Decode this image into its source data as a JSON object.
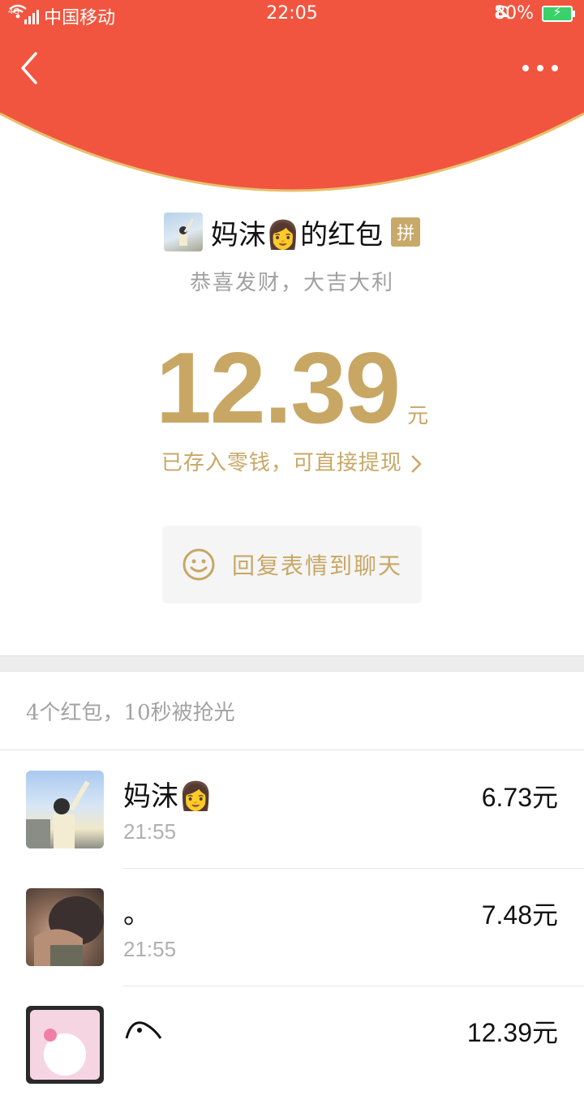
{
  "status_bar": {
    "network_type": "4G",
    "carrier": "中国移动",
    "time": "22:05",
    "battery": "80%",
    "icons": [
      "signal-icon",
      "wifi-icon",
      "mute-bell-icon",
      "battery-icon"
    ]
  },
  "header": {
    "background_color": "#f2553f",
    "accent_color": "#e6c06e",
    "back_icon": "back-arrow-icon",
    "more_icon": "more-dots-icon"
  },
  "packet": {
    "sender_name": "妈沫👩的红包",
    "badge": "拼",
    "blessing": "恭喜发财，大吉大利",
    "amount": "12.39",
    "unit": "元",
    "deposit_note": "已存入零钱，可直接提现",
    "reply_label": "回复表情到聊天",
    "reply_icon": "smiley-icon"
  },
  "summary": "4个红包，10秒被抢光",
  "receivers": [
    {
      "name": "妈沫👩",
      "time": "21:55",
      "amount": "6.73元"
    },
    {
      "name": "。",
      "time": "21:55",
      "amount": "7.48元"
    },
    {
      "name": "",
      "time": "",
      "amount": "12.39元"
    }
  ],
  "colors": {
    "gold": "#c8a765",
    "gray_text": "#a3a3a3"
  }
}
